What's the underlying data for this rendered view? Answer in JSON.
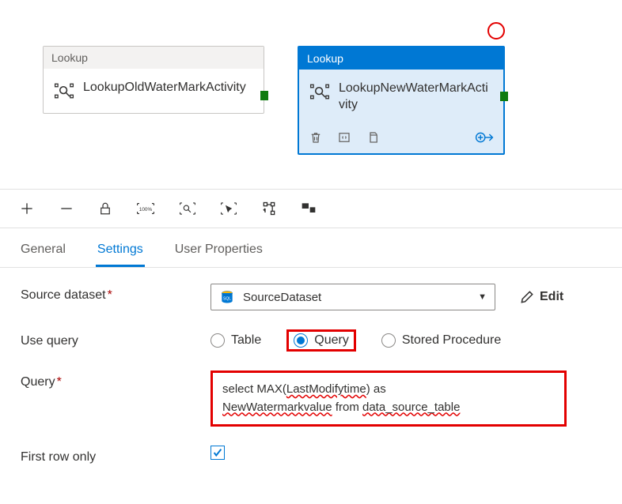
{
  "canvas": {
    "activity1": {
      "type": "Lookup",
      "name": "LookupOldWaterMarkActivity"
    },
    "activity2": {
      "type": "Lookup",
      "name": "LookupNewWaterMarkActivity"
    }
  },
  "tabs": {
    "general": "General",
    "settings": "Settings",
    "userProps": "User Properties"
  },
  "form": {
    "sourceDatasetLabel": "Source dataset",
    "sourceDatasetValue": "SourceDataset",
    "editLabel": "Edit",
    "useQueryLabel": "Use query",
    "radioTable": "Table",
    "radioQuery": "Query",
    "radioSP": "Stored Procedure",
    "queryLabel": "Query",
    "queryText": {
      "part1": "select MAX(",
      "err1": "LastModifytime",
      "part2": ") as ",
      "err2": "NewWatermarkvalue",
      "part3": " from ",
      "err3": "data_source_table"
    },
    "firstRowLabel": "First row only"
  }
}
